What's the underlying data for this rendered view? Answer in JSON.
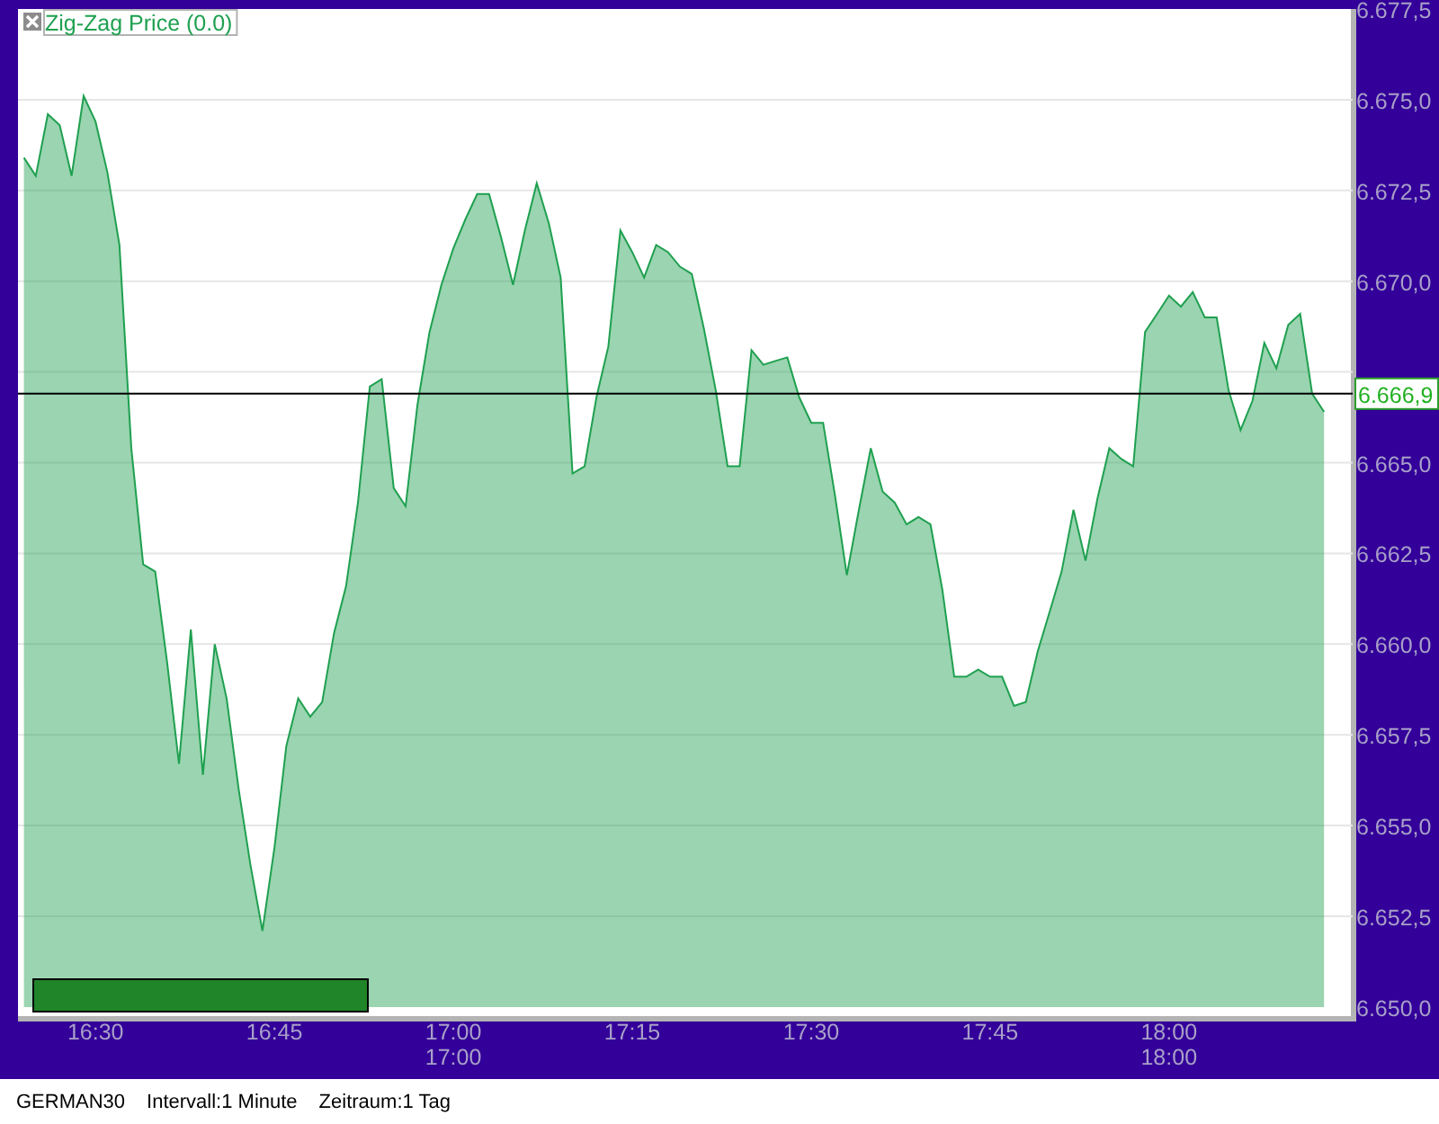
{
  "chart": {
    "chart_data": {
      "type": "area",
      "ylim": [
        6649.75,
        6677.5
      ],
      "grid": true,
      "categories": [
        null,
        null,
        null,
        null,
        null,
        null,
        "16:30",
        null,
        null,
        null,
        null,
        null,
        null,
        null,
        null,
        null,
        null,
        null,
        null,
        null,
        null,
        "16:45",
        null,
        null,
        null,
        null,
        null,
        null,
        null,
        null,
        null,
        null,
        null,
        null,
        null,
        null,
        "17:00",
        null,
        null,
        null,
        null,
        null,
        null,
        null,
        null,
        null,
        null,
        null,
        null,
        null,
        null,
        "17:15",
        null,
        null,
        null,
        null,
        null,
        null,
        null,
        null,
        null,
        null,
        null,
        null,
        null,
        null,
        "17:30",
        null,
        null,
        null,
        null,
        null,
        null,
        null,
        null,
        null,
        null,
        null,
        null,
        null,
        null,
        "17:45",
        null,
        null,
        null,
        null,
        null,
        null,
        null,
        null,
        null,
        null,
        null,
        null,
        null,
        null,
        "18:00",
        null,
        null,
        null,
        null,
        null,
        null,
        null,
        null,
        null,
        null,
        null,
        null,
        null
      ],
      "yticks": [
        {
          "value": 6650,
          "label": "6.650,0"
        },
        {
          "value": 6652.5,
          "label": "6.652,5"
        },
        {
          "value": 6655,
          "label": "6.655,0"
        },
        {
          "value": 6657.5,
          "label": "6.657,5"
        },
        {
          "value": 6660,
          "label": "6.660,0"
        },
        {
          "value": 6662.5,
          "label": "6.662,5"
        },
        {
          "value": 6665,
          "label": "6.665,0"
        },
        {
          "value": 6670,
          "label": "6.670,0"
        },
        {
          "value": 6672.5,
          "label": "6.672,5"
        },
        {
          "value": 6675,
          "label": "6.675,0"
        },
        {
          "value": 6677.5,
          "label": "6.677,5"
        }
      ],
      "series": [
        {
          "name": "Zig-Zag Price (0.0)",
          "color": "#1fa050",
          "values": [
            6673.4,
            6672.9,
            6674.6,
            6674.3,
            6672.9,
            6675.1,
            6674.4,
            6673.0,
            6671.0,
            6665.4,
            6662.2,
            6662.0,
            6659.5,
            6656.7,
            6660.4,
            6656.4,
            6660.0,
            6658.5,
            6656.0,
            6653.9,
            6652.1,
            6654.4,
            6657.2,
            6658.5,
            6658.0,
            6658.4,
            6660.3,
            6661.6,
            6663.9,
            6667.1,
            6667.3,
            6664.3,
            6663.8,
            6666.6,
            6668.6,
            6669.9,
            6670.9,
            6671.7,
            6672.4,
            6672.4,
            6671.2,
            6669.9,
            6671.4,
            6672.7,
            6671.6,
            6670.1,
            6664.7,
            6664.9,
            6666.8,
            6668.2,
            6671.4,
            6670.8,
            6670.1,
            6671.0,
            6670.8,
            6670.4,
            6670.2,
            6668.7,
            6667.0,
            6664.9,
            6664.9,
            6668.1,
            6667.7,
            6667.8,
            6667.9,
            6666.8,
            6666.1,
            6666.1,
            6664.1,
            6661.9,
            6663.7,
            6665.4,
            6664.2,
            6663.9,
            6663.3,
            6663.5,
            6663.3,
            6661.5,
            6659.1,
            6659.1,
            6659.3,
            6659.1,
            6659.1,
            6658.3,
            6658.4,
            6659.8,
            6660.9,
            6662.0,
            6663.7,
            6662.3,
            6664.0,
            6665.4,
            6665.1,
            6664.9,
            6668.6,
            6669.1,
            6669.6,
            6669.3,
            6669.7,
            6669.0,
            6669.0,
            6667.0,
            6665.9,
            6666.7,
            6668.3,
            6667.6,
            6668.8,
            6669.1,
            6666.9,
            6666.4
          ]
        }
      ],
      "ref_lines": [
        {
          "axis": "y",
          "value": 6666.9,
          "label": "6.666,9"
        }
      ]
    },
    "hour_labels": [
      {
        "text": "17:00"
      },
      {
        "text": "18:00"
      }
    ]
  },
  "status_bar": [
    {
      "text": "GERMAN30"
    },
    {
      "text": "Intervall:1 Minute"
    },
    {
      "text": "Zeitraum:1 Tag"
    }
  ]
}
